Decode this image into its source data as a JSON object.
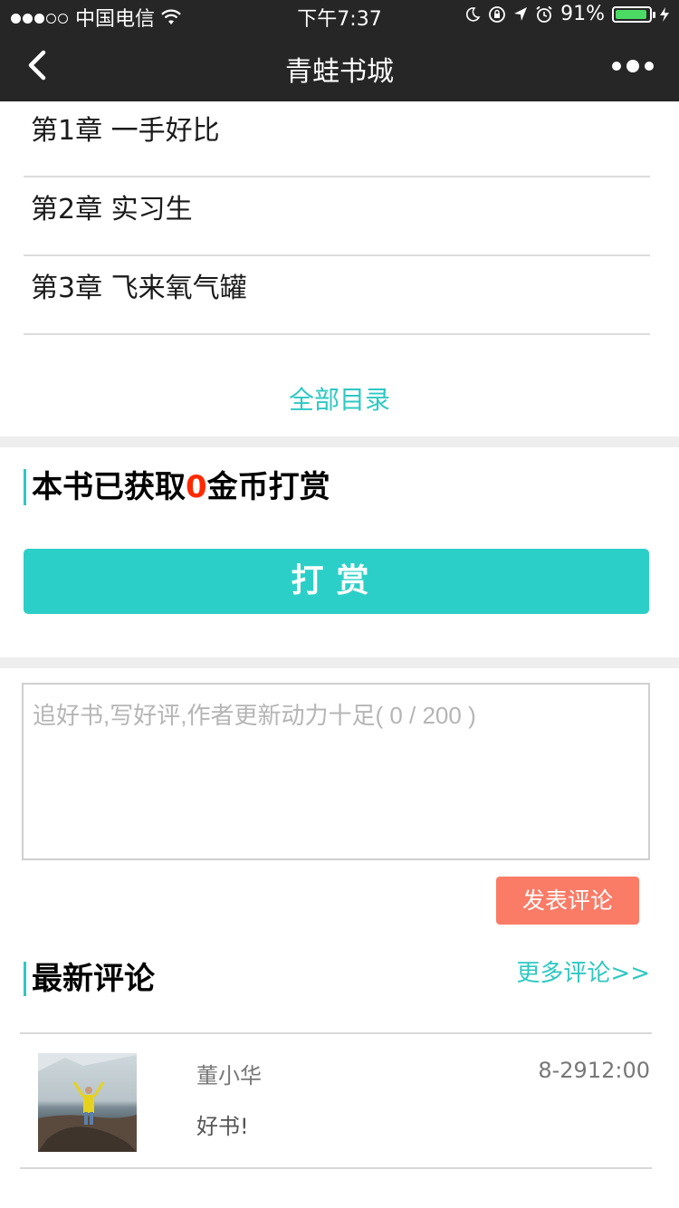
{
  "status_bar": {
    "carrier": "中国电信",
    "time": "下午7:37",
    "battery": "91%"
  },
  "nav": {
    "title": "青蛙书城",
    "back_icon": "chevron-left-icon",
    "more_icon": "more-dots-icon"
  },
  "chapters": [
    {
      "label": "第1章  一手好比"
    },
    {
      "label": "第2章  实习生"
    },
    {
      "label": "第3章  飞来氧气罐"
    }
  ],
  "catalog_link": "全部目录",
  "reward": {
    "title_prefix": "本书已获取",
    "count": "0",
    "title_suffix": "金币打赏",
    "button": "打赏"
  },
  "comment_form": {
    "placeholder": "追好书,写好评,作者更新动力十足( 0 / 200 )",
    "submit": "发表评论"
  },
  "latest": {
    "title": "最新评论",
    "more": "更多评论>>",
    "comments": [
      {
        "user": "董小华",
        "time": "8-2912:00",
        "text": "好书!"
      }
    ]
  },
  "colors": {
    "accent": "#2ec8c3",
    "reward_button": "#2ccfc7",
    "submit_button": "#fa7b66",
    "nav_bg": "#262626",
    "highlight": "#ff2a00"
  }
}
